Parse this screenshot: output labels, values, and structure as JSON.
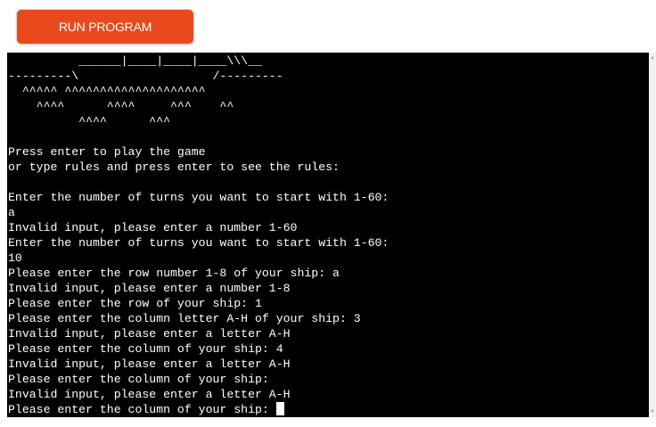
{
  "run_button": {
    "label": "RUN PROGRAM"
  },
  "terminal": {
    "lines": [
      "          ______|____|____|____\\\\\\__",
      "---------\\                   /---------",
      "  ^^^^^ ^^^^^^^^^^^^^^^^^^^^",
      "    ^^^^      ^^^^     ^^^    ^^",
      "          ^^^^      ^^^",
      "",
      "Press enter to play the game",
      "or type rules and press enter to see the rules:",
      "",
      "Enter the number of turns you want to start with 1-60:",
      "a",
      "Invalid input, please enter a number 1-60",
      "Enter the number of turns you want to start with 1-60:",
      "10",
      "Please enter the row number 1-8 of your ship: a",
      "Invalid input, please enter a number 1-8",
      "Please enter the row of your ship: 1",
      "Please enter the column letter A-H of your ship: 3",
      "Invalid input, please enter a letter A-H",
      "Please enter the column of your ship: 4",
      "Invalid input, please enter a letter A-H",
      "Please enter the column of your ship:",
      "Invalid input, please enter a letter A-H"
    ],
    "prompt_line": "Please enter the column of your ship: "
  },
  "scrollbar": {
    "up_icon": "triangle-up",
    "down_icon": "triangle-down"
  },
  "colors": {
    "button": "#e8491d",
    "terminal_bg": "#000000",
    "terminal_fg": "#ffffff"
  }
}
